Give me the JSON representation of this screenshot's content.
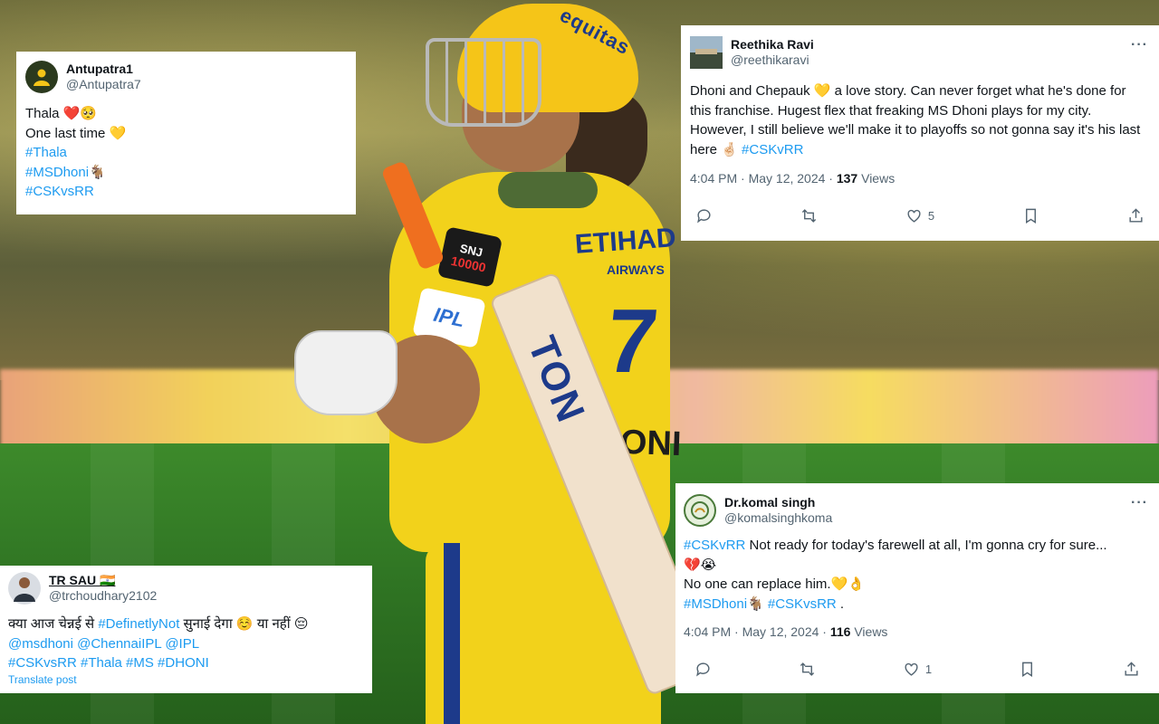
{
  "player": {
    "helmet_brand": "equitas",
    "sponsor": "ETIHAD",
    "sponsor_sub": "AIRWAYS",
    "number": "7",
    "name": "DHONI",
    "snj_top": "SNJ",
    "snj_bottom": "10000",
    "ipl_badge": "IPL",
    "bat_brand": "TON"
  },
  "tweets": [
    {
      "name": "Antupatra1",
      "handle": "@Antupatra7",
      "lines": [
        {
          "text": "Thala ❤️🥺",
          "type": "text"
        },
        {
          "text": "One last time 💛",
          "type": "text"
        },
        {
          "text": "#Thala",
          "type": "tag"
        },
        {
          "text": "#MSDhoni🐐",
          "type": "tag"
        },
        {
          "text": "#CSKvsRR",
          "type": "tag"
        }
      ]
    },
    {
      "name": "Reethika Ravi",
      "handle": "@reethikaravi",
      "more": "···",
      "text": "Dhoni and Chepauk 💛 a love story. Can never forget what he's done for this franchise. Hugest flex that freaking MS Dhoni plays for my city. However, I still believe we'll make it to playoffs so not gonna say it's his last here 🤞🏻",
      "tag": "#CSKvRR",
      "time": "4:04 PM · May 12, 2024 · ",
      "views_count": "137",
      "views_label": " Views",
      "likes": "5"
    },
    {
      "name": "TR SAU 🇮🇳",
      "handle": "@trchoudhary2102",
      "line1_pre": "क्या आज चेन्नई से ",
      "line1_tag": "#DefinetlyNot",
      "line1_post": " सुनाई देगा ☺️ या नहीं 😔",
      "line2": "@msdhoni @ChennaiIPL @IPL",
      "line3": "#CSKvsRR #Thala #MS #DHONI",
      "translate": "Translate post"
    },
    {
      "name": "Dr.komal singh",
      "handle": "@komalsinghkoma",
      "more": "···",
      "tag1": "#CSKvRR",
      "line1": " Not ready for today's farewell at all, I'm gonna cry for sure...",
      "line2": "💔😭",
      "line3": "No one can replace him.💛👌",
      "line4_tags": "#MSDhoni🐐 #CSKvsRR",
      "line4_post": " .",
      "time": "4:04 PM · May 12, 2024 · ",
      "views_count": "116",
      "views_label": " Views",
      "likes": "1"
    }
  ],
  "colors": {
    "link": "#1d9bf0",
    "text": "#0f1419",
    "muted": "#536471",
    "csk_yellow": "#f2d21b",
    "csk_blue": "#1d3a8a"
  }
}
